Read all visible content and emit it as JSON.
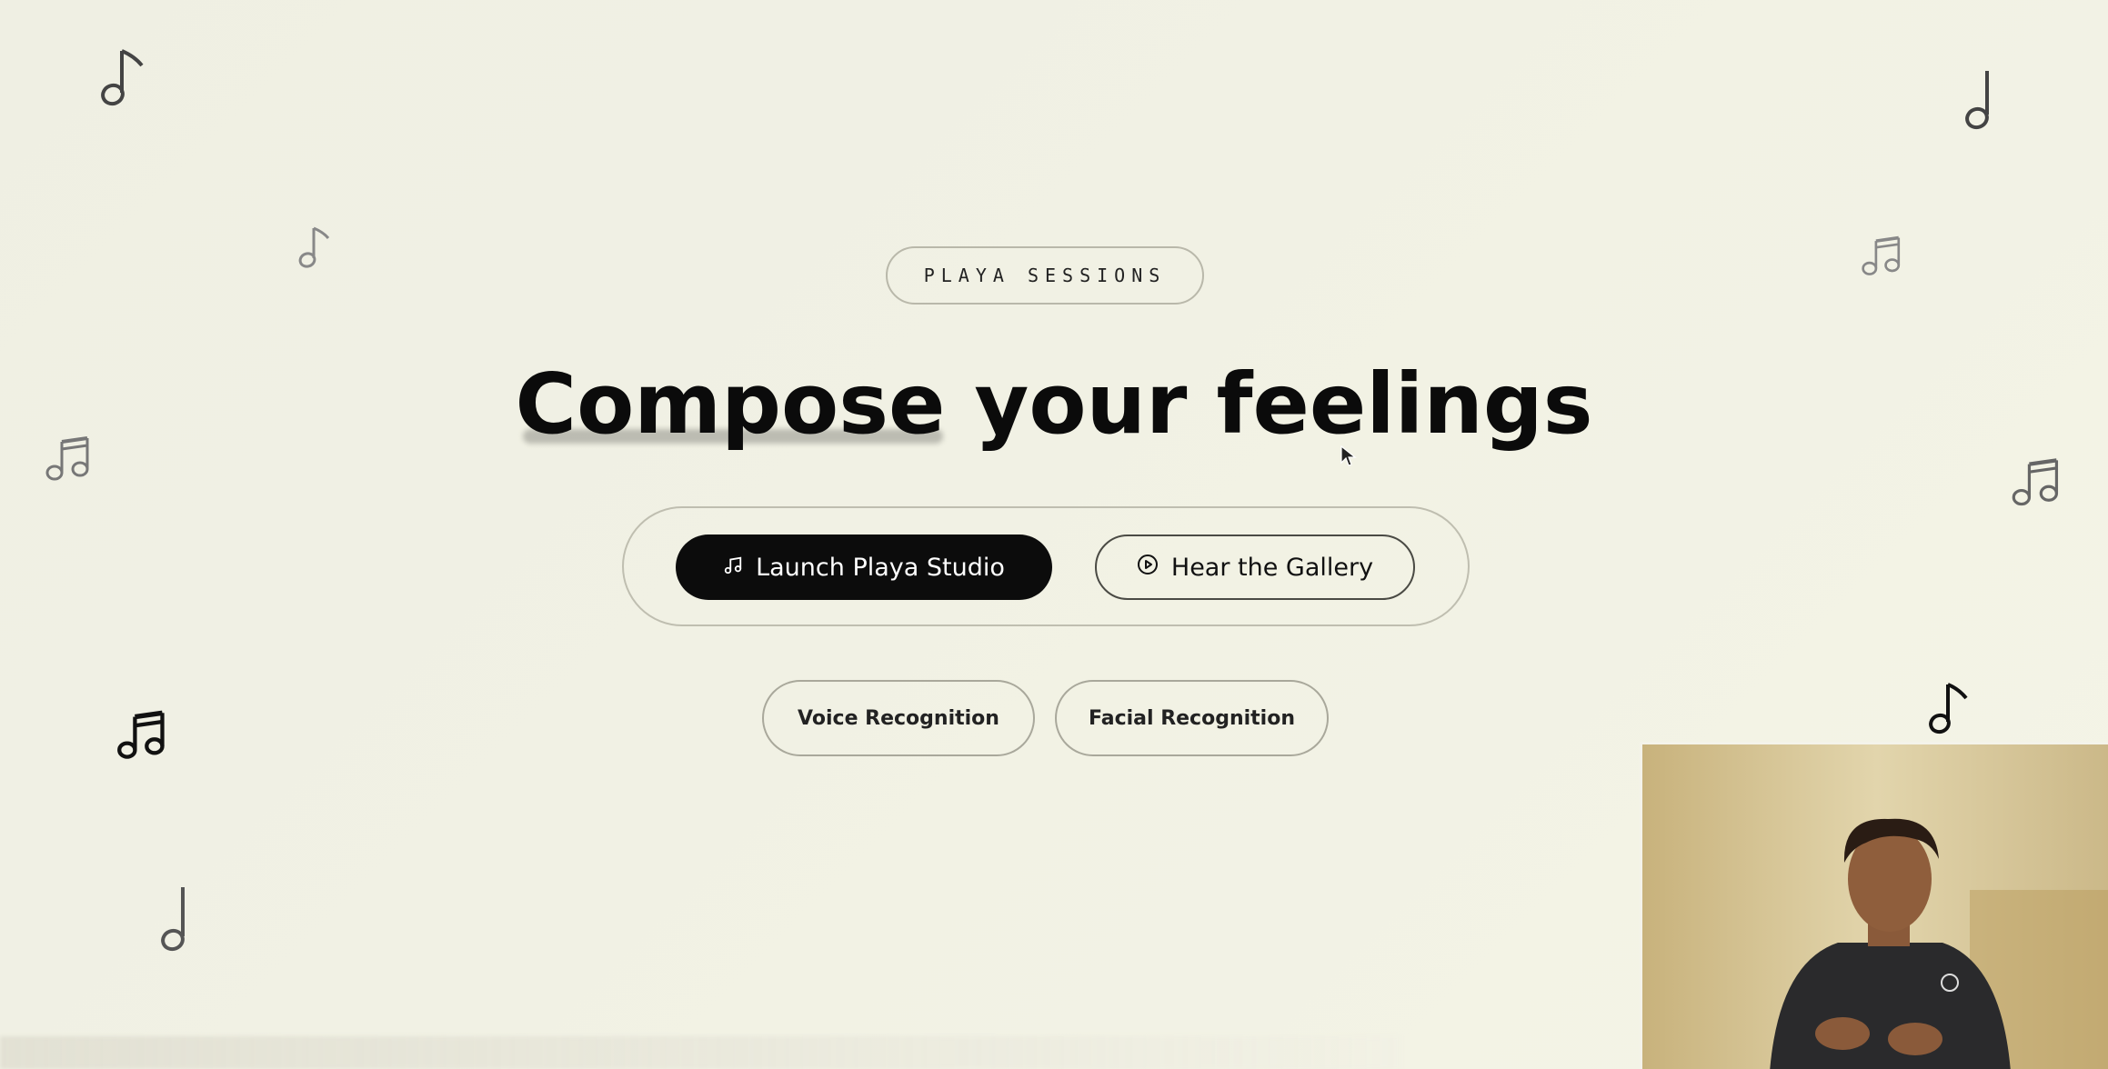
{
  "tag": {
    "label": "PLAYA SESSIONS"
  },
  "hero": {
    "headline": "Compose your feelings"
  },
  "actions": {
    "primary": {
      "label": "Launch Playa Studio",
      "icon": "music-note-icon"
    },
    "secondary": {
      "label": "Hear the Gallery",
      "icon": "play-circle-icon"
    }
  },
  "modes": [
    {
      "label": "Voice Recognition"
    },
    {
      "label": "Facial Recognition"
    }
  ],
  "decor": {
    "notes": [
      "eighth-note-icon",
      "half-note-icon",
      "beamed-notes-icon"
    ]
  },
  "video": {
    "subject": "presenter-webcam"
  },
  "colors": {
    "background": "#f0f0e3",
    "primary_button": "#0c0c0c",
    "webcam_wall": "#d8c898"
  }
}
